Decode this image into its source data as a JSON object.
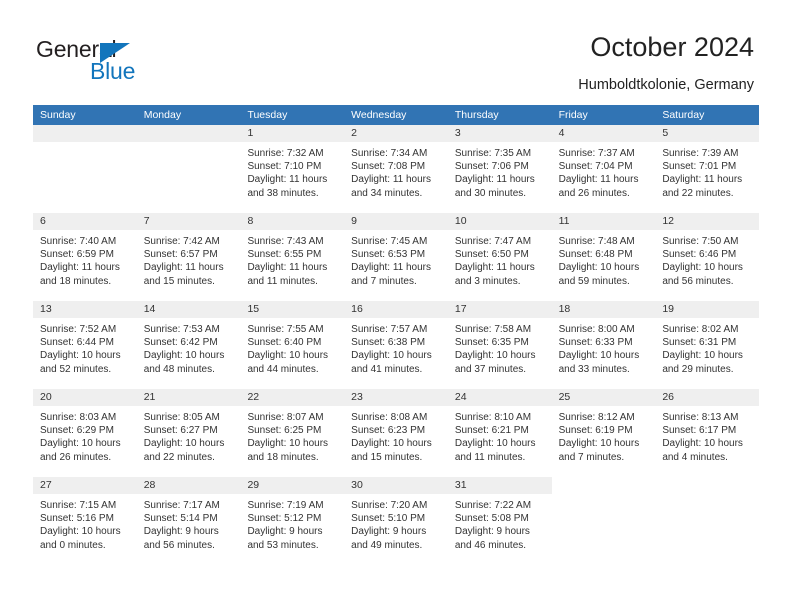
{
  "logo": {
    "word_one": "General",
    "word_two": "Blue",
    "triangle": "triangle-icon",
    "brand_color": "#1275bc"
  },
  "header": {
    "title": "October 2024",
    "subtitle": "Humboldtkolonie, Germany"
  },
  "calendar": {
    "header_bg": "#3174b4",
    "rule_color": "#2b6ca8",
    "datebar_bg": "#efefef",
    "day_names": [
      "Sunday",
      "Monday",
      "Tuesday",
      "Wednesday",
      "Thursday",
      "Friday",
      "Saturday"
    ],
    "weeks": [
      [
        {
          "day": "",
          "blank": true
        },
        {
          "day": "",
          "blank": true
        },
        {
          "day": "1",
          "sunrise": "Sunrise: 7:32 AM",
          "sunset": "Sunset: 7:10 PM",
          "daylight": "Daylight: 11 hours and 38 minutes."
        },
        {
          "day": "2",
          "sunrise": "Sunrise: 7:34 AM",
          "sunset": "Sunset: 7:08 PM",
          "daylight": "Daylight: 11 hours and 34 minutes."
        },
        {
          "day": "3",
          "sunrise": "Sunrise: 7:35 AM",
          "sunset": "Sunset: 7:06 PM",
          "daylight": "Daylight: 11 hours and 30 minutes."
        },
        {
          "day": "4",
          "sunrise": "Sunrise: 7:37 AM",
          "sunset": "Sunset: 7:04 PM",
          "daylight": "Daylight: 11 hours and 26 minutes."
        },
        {
          "day": "5",
          "sunrise": "Sunrise: 7:39 AM",
          "sunset": "Sunset: 7:01 PM",
          "daylight": "Daylight: 11 hours and 22 minutes."
        }
      ],
      [
        {
          "day": "6",
          "sunrise": "Sunrise: 7:40 AM",
          "sunset": "Sunset: 6:59 PM",
          "daylight": "Daylight: 11 hours and 18 minutes."
        },
        {
          "day": "7",
          "sunrise": "Sunrise: 7:42 AM",
          "sunset": "Sunset: 6:57 PM",
          "daylight": "Daylight: 11 hours and 15 minutes."
        },
        {
          "day": "8",
          "sunrise": "Sunrise: 7:43 AM",
          "sunset": "Sunset: 6:55 PM",
          "daylight": "Daylight: 11 hours and 11 minutes."
        },
        {
          "day": "9",
          "sunrise": "Sunrise: 7:45 AM",
          "sunset": "Sunset: 6:53 PM",
          "daylight": "Daylight: 11 hours and 7 minutes."
        },
        {
          "day": "10",
          "sunrise": "Sunrise: 7:47 AM",
          "sunset": "Sunset: 6:50 PM",
          "daylight": "Daylight: 11 hours and 3 minutes."
        },
        {
          "day": "11",
          "sunrise": "Sunrise: 7:48 AM",
          "sunset": "Sunset: 6:48 PM",
          "daylight": "Daylight: 10 hours and 59 minutes."
        },
        {
          "day": "12",
          "sunrise": "Sunrise: 7:50 AM",
          "sunset": "Sunset: 6:46 PM",
          "daylight": "Daylight: 10 hours and 56 minutes."
        }
      ],
      [
        {
          "day": "13",
          "sunrise": "Sunrise: 7:52 AM",
          "sunset": "Sunset: 6:44 PM",
          "daylight": "Daylight: 10 hours and 52 minutes."
        },
        {
          "day": "14",
          "sunrise": "Sunrise: 7:53 AM",
          "sunset": "Sunset: 6:42 PM",
          "daylight": "Daylight: 10 hours and 48 minutes."
        },
        {
          "day": "15",
          "sunrise": "Sunrise: 7:55 AM",
          "sunset": "Sunset: 6:40 PM",
          "daylight": "Daylight: 10 hours and 44 minutes."
        },
        {
          "day": "16",
          "sunrise": "Sunrise: 7:57 AM",
          "sunset": "Sunset: 6:38 PM",
          "daylight": "Daylight: 10 hours and 41 minutes."
        },
        {
          "day": "17",
          "sunrise": "Sunrise: 7:58 AM",
          "sunset": "Sunset: 6:35 PM",
          "daylight": "Daylight: 10 hours and 37 minutes."
        },
        {
          "day": "18",
          "sunrise": "Sunrise: 8:00 AM",
          "sunset": "Sunset: 6:33 PM",
          "daylight": "Daylight: 10 hours and 33 minutes."
        },
        {
          "day": "19",
          "sunrise": "Sunrise: 8:02 AM",
          "sunset": "Sunset: 6:31 PM",
          "daylight": "Daylight: 10 hours and 29 minutes."
        }
      ],
      [
        {
          "day": "20",
          "sunrise": "Sunrise: 8:03 AM",
          "sunset": "Sunset: 6:29 PM",
          "daylight": "Daylight: 10 hours and 26 minutes."
        },
        {
          "day": "21",
          "sunrise": "Sunrise: 8:05 AM",
          "sunset": "Sunset: 6:27 PM",
          "daylight": "Daylight: 10 hours and 22 minutes."
        },
        {
          "day": "22",
          "sunrise": "Sunrise: 8:07 AM",
          "sunset": "Sunset: 6:25 PM",
          "daylight": "Daylight: 10 hours and 18 minutes."
        },
        {
          "day": "23",
          "sunrise": "Sunrise: 8:08 AM",
          "sunset": "Sunset: 6:23 PM",
          "daylight": "Daylight: 10 hours and 15 minutes."
        },
        {
          "day": "24",
          "sunrise": "Sunrise: 8:10 AM",
          "sunset": "Sunset: 6:21 PM",
          "daylight": "Daylight: 10 hours and 11 minutes."
        },
        {
          "day": "25",
          "sunrise": "Sunrise: 8:12 AM",
          "sunset": "Sunset: 6:19 PM",
          "daylight": "Daylight: 10 hours and 7 minutes."
        },
        {
          "day": "26",
          "sunrise": "Sunrise: 8:13 AM",
          "sunset": "Sunset: 6:17 PM",
          "daylight": "Daylight: 10 hours and 4 minutes."
        }
      ],
      [
        {
          "day": "27",
          "sunrise": "Sunrise: 7:15 AM",
          "sunset": "Sunset: 5:16 PM",
          "daylight": "Daylight: 10 hours and 0 minutes."
        },
        {
          "day": "28",
          "sunrise": "Sunrise: 7:17 AM",
          "sunset": "Sunset: 5:14 PM",
          "daylight": "Daylight: 9 hours and 56 minutes."
        },
        {
          "day": "29",
          "sunrise": "Sunrise: 7:19 AM",
          "sunset": "Sunset: 5:12 PM",
          "daylight": "Daylight: 9 hours and 53 minutes."
        },
        {
          "day": "30",
          "sunrise": "Sunrise: 7:20 AM",
          "sunset": "Sunset: 5:10 PM",
          "daylight": "Daylight: 9 hours and 49 minutes."
        },
        {
          "day": "31",
          "sunrise": "Sunrise: 7:22 AM",
          "sunset": "Sunset: 5:08 PM",
          "daylight": "Daylight: 9 hours and 46 minutes."
        },
        {
          "day": "",
          "blank": true
        },
        {
          "day": "",
          "blank": true
        }
      ]
    ]
  }
}
